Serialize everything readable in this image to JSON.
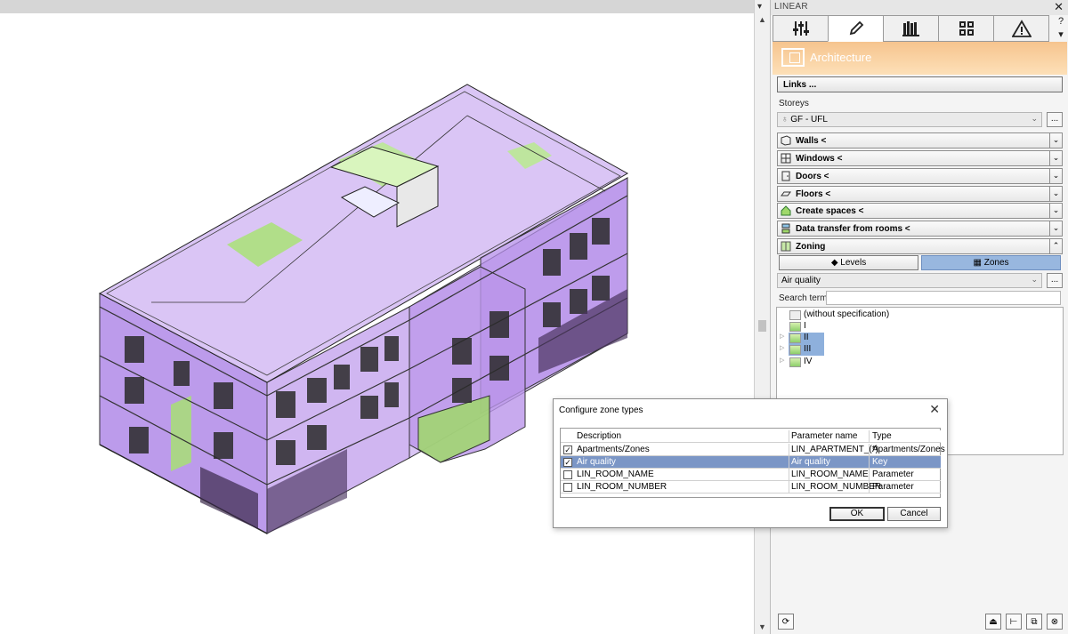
{
  "panel": {
    "title": "LINEAR",
    "header_title": "Architecture",
    "links_label": "Links ...",
    "storeys_label": "Storeys",
    "storey_value": "GF - UFL",
    "dots_label": "...",
    "sections": [
      {
        "label": "Walls <"
      },
      {
        "label": "Windows <"
      },
      {
        "label": "Doors <"
      },
      {
        "label": "Floors <"
      },
      {
        "label": "Create spaces <"
      },
      {
        "label": "Data transfer from rooms <"
      },
      {
        "label": "Zoning"
      }
    ],
    "zoning": {
      "levels_label": "Levels",
      "zones_label": "Zones",
      "zone_type_value": "Air quality",
      "search_label": "Search term",
      "tree": [
        {
          "label": "(without specification)"
        },
        {
          "label": "I"
        },
        {
          "label": "II"
        },
        {
          "label": "III"
        },
        {
          "label": "IV"
        }
      ]
    },
    "accent_color": "#f6c48e",
    "selection_color": "#8eb0dc"
  },
  "dialog": {
    "title": "Configure zone types",
    "columns": [
      "Description",
      "Parameter name",
      "Type"
    ],
    "rows": [
      {
        "checked": "✓",
        "description": "Apartments/Zones",
        "parameter": "LIN_APARTMENT_(*)",
        "type": "Apartments/Zones"
      },
      {
        "checked": "✓",
        "description": "Air quality",
        "parameter": "Air quality",
        "type": "Key"
      },
      {
        "checked": "",
        "description": "LIN_ROOM_NAME",
        "parameter": "LIN_ROOM_NAME",
        "type": "Parameter"
      },
      {
        "checked": "",
        "description": "LIN_ROOM_NUMBER",
        "parameter": "LIN_ROOM_NUMBER",
        "type": "Parameter"
      }
    ],
    "ok_label": "OK",
    "cancel_label": "Cancel"
  }
}
